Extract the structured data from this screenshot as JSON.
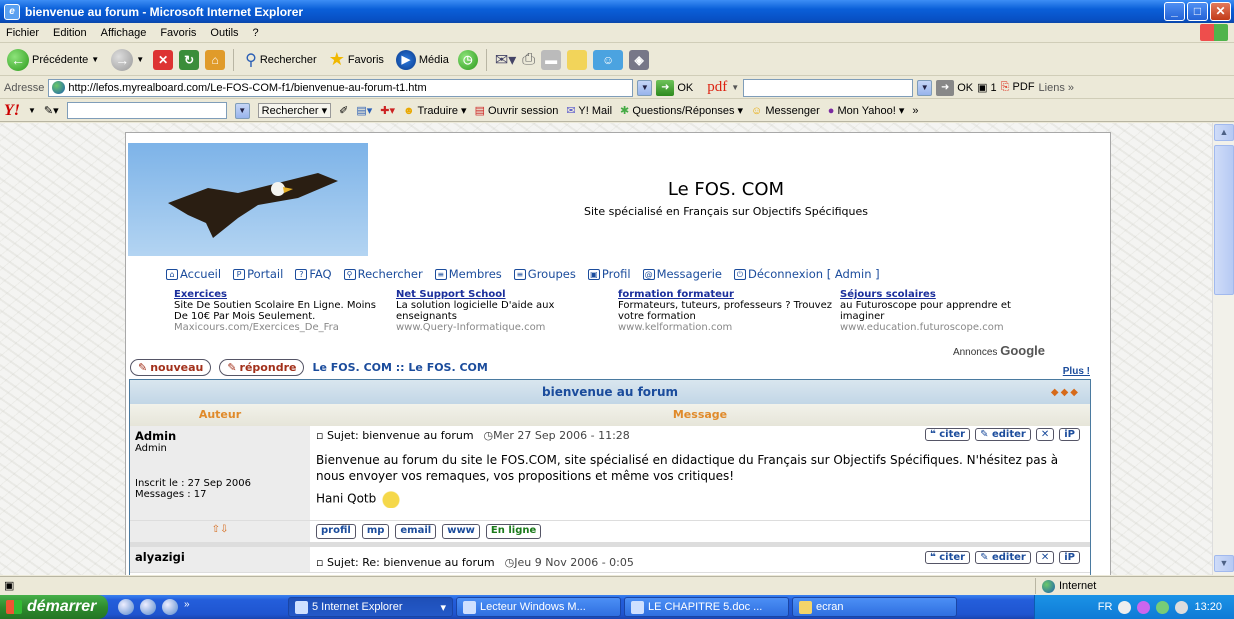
{
  "window": {
    "title": "bienvenue au forum - Microsoft Internet Explorer"
  },
  "menu": [
    "Fichier",
    "Edition",
    "Affichage",
    "Favoris",
    "Outils",
    "?"
  ],
  "toolbar": {
    "back": "Précédente",
    "search": "Rechercher",
    "favorites": "Favoris",
    "media": "Média"
  },
  "address": {
    "label": "Adresse",
    "url": "http://lefos.myrealboard.com/Le-FOS-COM-f1/bienvenue-au-forum-t1.htm",
    "ok": "OK",
    "pdf": "pdf",
    "ok2": "OK",
    "count": "1",
    "pdf_btn": "PDF",
    "links": "Liens"
  },
  "yahoo": {
    "search": "Rechercher",
    "translate": "Traduire",
    "open_session": "Ouvrir session",
    "mail": "Y! Mail",
    "qa": "Questions/Réponses",
    "messenger": "Messenger",
    "myyahoo": "Mon Yahoo!"
  },
  "site": {
    "title": "Le FOS. COM",
    "subtitle": "Site spécialisé en Français sur Objectifs Spécifiques"
  },
  "nav": [
    {
      "label": "Accueil"
    },
    {
      "label": "Portail"
    },
    {
      "label": "FAQ"
    },
    {
      "label": "Rechercher"
    },
    {
      "label": "Membres"
    },
    {
      "label": "Groupes"
    },
    {
      "label": "Profil"
    },
    {
      "label": "Messagerie"
    },
    {
      "label": "Déconnexion [ Admin ]"
    }
  ],
  "ads": [
    {
      "head": "Exercices",
      "text": "Site De Soutien Scolaire En Ligne. Moins De 10€ Par Mois Seulement.",
      "url": "Maxicours.com/Exercices_De_Fra"
    },
    {
      "head": "Net Support School",
      "text": "La solution logicielle D'aide aux enseignants",
      "url": "www.Query-Informatique.com"
    },
    {
      "head": "formation formateur",
      "text": "Formateurs, tuteurs, professeurs ? Trouvez votre formation",
      "url": "www.kelformation.com"
    },
    {
      "head": "Séjours scolaires",
      "text": "au Futuroscope pour apprendre et imaginer",
      "url": "www.education.futuroscope.com"
    }
  ],
  "annonces": {
    "label": "Annonces",
    "brand": "Google"
  },
  "actions": {
    "new": "nouveau",
    "reply": "répondre",
    "crumb": "Le FOS. COM :: Le FOS. COM",
    "plus": "Plus !"
  },
  "forum": {
    "topic": "bienvenue au forum",
    "col_author": "Auteur",
    "col_message": "Message",
    "posts": [
      {
        "author": "Admin",
        "rank": "Admin",
        "registered": "Inscrit le : 27 Sep 2006",
        "messages": "Messages : 17",
        "subject": "Sujet: bienvenue au forum",
        "date": "Mer 27 Sep 2006 - 11:28",
        "body": "Bienvenue au forum du site le FOS.COM, site spécialisé en didactique du Français sur Objectifs Spécifiques. N'hésitez pas à nous envoyer vos remaques, vos propositions et même vos critiques!",
        "signature": "Hani Qotb"
      },
      {
        "author": "alyazigi",
        "subject": "Sujet: Re: bienvenue au forum",
        "date": "Jeu 9 Nov 2006 - 0:05"
      }
    ],
    "buttons": {
      "quote": "citer",
      "edit": "editer",
      "delete": "✕",
      "ip": "iP"
    },
    "profile_buttons": [
      "profil",
      "mp",
      "email",
      "www",
      "En ligne"
    ]
  },
  "status": {
    "zone": "Internet"
  },
  "taskbar": {
    "start": "démarrer",
    "tasks": [
      "5 Internet Explorer",
      "Lecteur Windows M...",
      "LE CHAPITRE 5.doc ...",
      "ecran"
    ],
    "lang": "FR",
    "clock": "13:20"
  }
}
